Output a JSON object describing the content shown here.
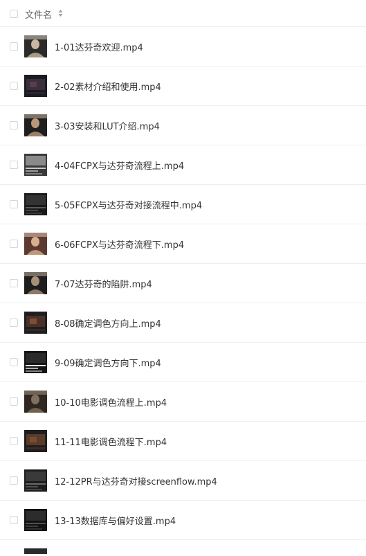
{
  "header": {
    "name_label": "文件名",
    "sort_icon": "sort-icon"
  },
  "files": [
    {
      "name": "1-01达芬奇欢迎.mp4",
      "thumb": "person",
      "colors": [
        "#c9b7a0",
        "#2b2b2b",
        "#e8e0d0"
      ]
    },
    {
      "name": "2-02素材介绍和使用.mp4",
      "thumb": "dark",
      "colors": [
        "#3a2f3a",
        "#1b1b22",
        "#6b4a5a"
      ]
    },
    {
      "name": "3-03安装和LUT介绍.mp4",
      "thumb": "person",
      "colors": [
        "#b89878",
        "#1e1e1e",
        "#d9c8b4"
      ]
    },
    {
      "name": "4-04FCPX与达芬奇流程上.mp4",
      "thumb": "ui",
      "colors": [
        "#8a8a8a",
        "#3a3a3a",
        "#c8c8c8"
      ]
    },
    {
      "name": "5-05FCPX与达芬奇对接流程中.mp4",
      "thumb": "ui",
      "colors": [
        "#333333",
        "#1a1a1a",
        "#5a5a5a"
      ]
    },
    {
      "name": "6-06FCPX与达芬奇流程下.mp4",
      "thumb": "portrait",
      "colors": [
        "#d8b090",
        "#5c3a30",
        "#f0d8c0"
      ]
    },
    {
      "name": "7-07达芬奇的陷阱.mp4",
      "thumb": "person",
      "colors": [
        "#a89078",
        "#1e1e1e",
        "#d0c0a8"
      ]
    },
    {
      "name": "8-08确定调色方向上.mp4",
      "thumb": "dark",
      "colors": [
        "#4a3028",
        "#1e1e1e",
        "#a06040"
      ]
    },
    {
      "name": "9-09确定调色方向下.mp4",
      "thumb": "ui",
      "colors": [
        "#2a2a2a",
        "#141414",
        "#f0f0f0"
      ]
    },
    {
      "name": "10-10电影调色流程上.mp4",
      "thumb": "portrait",
      "colors": [
        "#807060",
        "#302820",
        "#b0a090"
      ]
    },
    {
      "name": "11-11电影调色流程下.mp4",
      "thumb": "dark",
      "colors": [
        "#5a3a28",
        "#1e1e1e",
        "#8a5a3a"
      ]
    },
    {
      "name": "12-12PR与达芬奇对接screenflow.mp4",
      "thumb": "ui",
      "colors": [
        "#3a3a3a",
        "#1c1c1c",
        "#6a6a6a"
      ]
    },
    {
      "name": "13-13数据库与偏好设置.mp4",
      "thumb": "ui",
      "colors": [
        "#2c2c2c",
        "#121212",
        "#505050"
      ]
    }
  ]
}
